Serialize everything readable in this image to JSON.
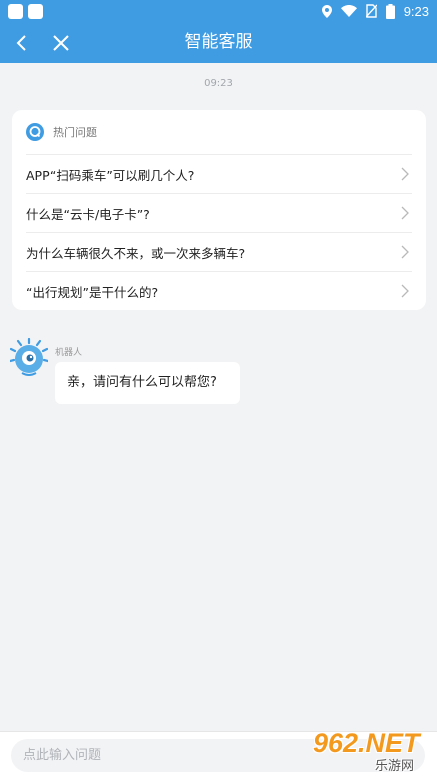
{
  "status_bar": {
    "time": "9:23",
    "icons": [
      "notification-square-icon",
      "notification-square-icon",
      "location-icon",
      "wifi-icon",
      "no-sim-icon",
      "battery-icon"
    ]
  },
  "header": {
    "title": "智能客服",
    "back_icon": "chevron-left-icon",
    "close_icon": "close-icon",
    "background_color": "#3f9be2"
  },
  "chat": {
    "timestamp": "09:23",
    "faq": {
      "heading": "热门问题",
      "items": [
        "APP“扫码乘车”可以刷几个人?",
        "什么是“云卡/电子卡”?",
        "为什么车辆很久不来，或一次来多辆车?",
        "“出行规划”是干什么的?"
      ]
    },
    "bot": {
      "name": "机器人",
      "message": "亲，请问有什么可以帮您?"
    }
  },
  "input": {
    "placeholder": "点此输入问题",
    "value": ""
  },
  "watermark": {
    "brand": "962.NET",
    "sub": "乐游网"
  }
}
